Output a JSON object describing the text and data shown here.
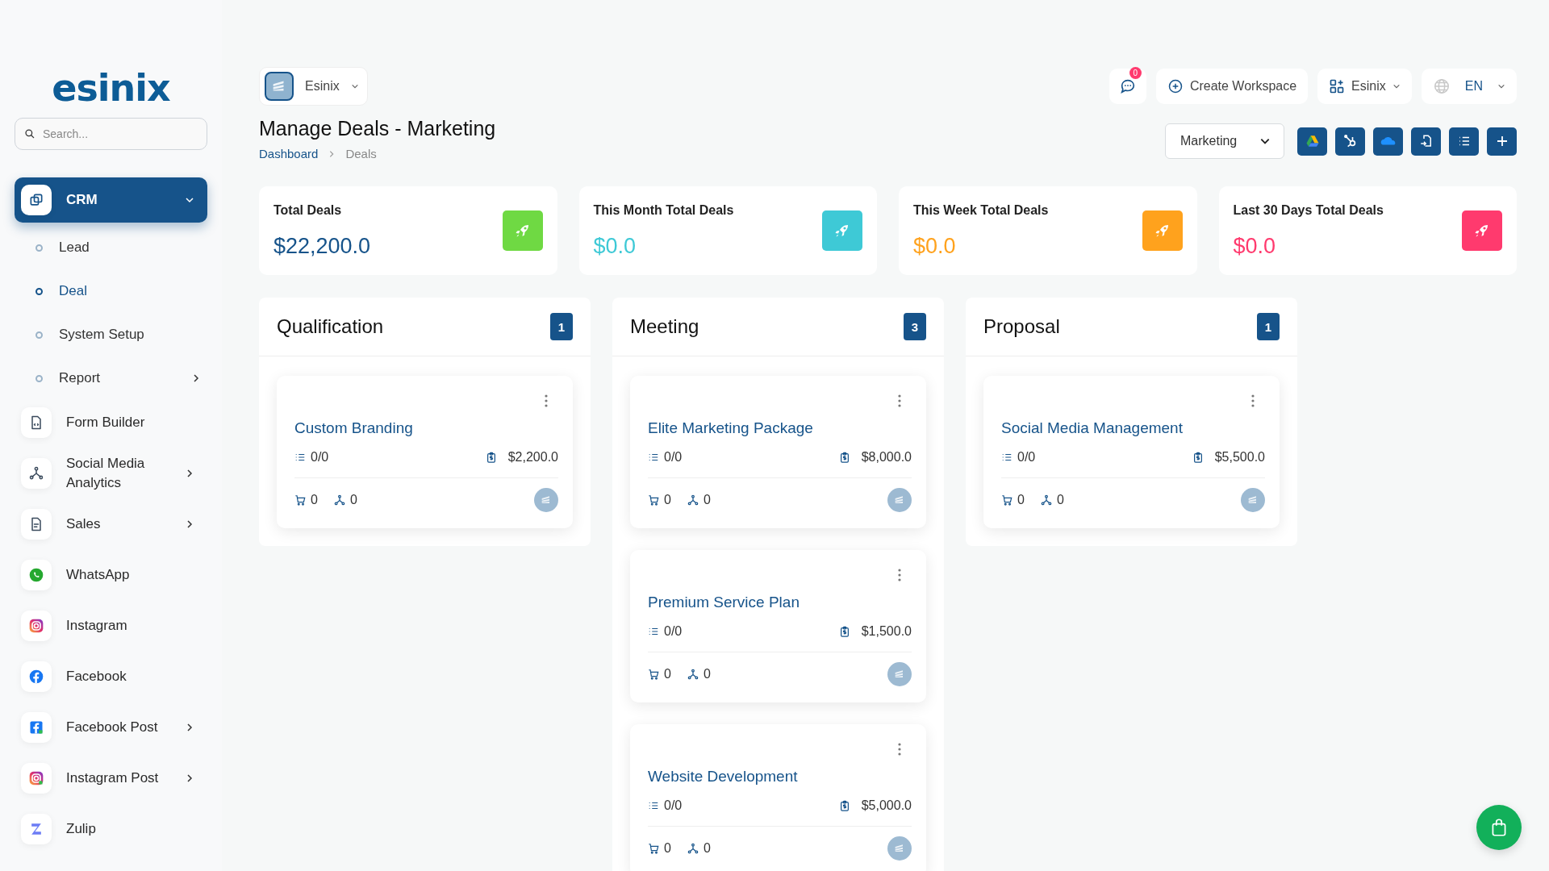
{
  "sidebar": {
    "logo": "esinix",
    "search": {
      "placeholder": "Search..."
    },
    "items": [
      {
        "label": "CRM",
        "selected": true,
        "expanded": true,
        "submenu": true,
        "children": [
          {
            "label": "Lead",
            "selected": false,
            "submenu": false
          },
          {
            "label": "Deal",
            "selected": true,
            "submenu": false
          },
          {
            "label": "System Setup",
            "selected": false,
            "submenu": false
          },
          {
            "label": "Report",
            "selected": false,
            "submenu": true
          }
        ]
      },
      {
        "label": "Form Builder",
        "selected": false,
        "submenu": false
      },
      {
        "label": "Social Media Analytics",
        "selected": false,
        "submenu": true
      },
      {
        "label": "Sales",
        "selected": false,
        "submenu": true
      },
      {
        "label": "WhatsApp",
        "selected": false,
        "submenu": false
      },
      {
        "label": "Instagram",
        "selected": false,
        "submenu": false
      },
      {
        "label": "Facebook",
        "selected": false,
        "submenu": false
      },
      {
        "label": "Facebook Post",
        "selected": false,
        "submenu": true
      },
      {
        "label": "Instagram Post",
        "selected": false,
        "submenu": true
      },
      {
        "label": "Zulip",
        "selected": false,
        "submenu": false
      }
    ]
  },
  "topbar": {
    "company": "Esinix",
    "messages_badge": "0",
    "create_workspace": "Create Workspace",
    "workspace": "Esinix",
    "language": "EN"
  },
  "page": {
    "title": "Manage Deals - Marketing",
    "breadcrumb": [
      "Dashboard",
      "Deals"
    ],
    "pipeline": "Marketing"
  },
  "stats": [
    {
      "title": "Total Deals",
      "value": "$22,200.0",
      "color": "#6fd943",
      "value_tinted": false
    },
    {
      "title": "This Month Total Deals",
      "value": "$0.0",
      "color": "#3ec9d6",
      "value_tinted": true
    },
    {
      "title": "This Week Total Deals",
      "value": "$0.0",
      "color": "#ffa21d",
      "value_tinted": true
    },
    {
      "title": "Last 30 Days Total Deals",
      "value": "$0.0",
      "color": "#ff3a6e",
      "value_tinted": true
    }
  ],
  "columns": [
    {
      "title": "Qualification",
      "count": "1",
      "deals": [
        {
          "title": "Custom Branding",
          "tasks": "0/0",
          "amount": "$2,200.0",
          "products": "0",
          "sources": "0"
        }
      ]
    },
    {
      "title": "Meeting",
      "count": "3",
      "deals": [
        {
          "title": "Elite Marketing Package",
          "tasks": "0/0",
          "amount": "$8,000.0",
          "products": "0",
          "sources": "0"
        },
        {
          "title": "Premium Service Plan",
          "tasks": "0/0",
          "amount": "$1,500.0",
          "products": "0",
          "sources": "0"
        },
        {
          "title": "Website Development",
          "tasks": "0/0",
          "amount": "$5,000.0",
          "products": "0",
          "sources": "0"
        }
      ]
    },
    {
      "title": "Proposal",
      "count": "1",
      "deals": [
        {
          "title": "Social Media Management",
          "tasks": "0/0",
          "amount": "$5,500.0",
          "products": "0",
          "sources": "0"
        }
      ]
    }
  ]
}
